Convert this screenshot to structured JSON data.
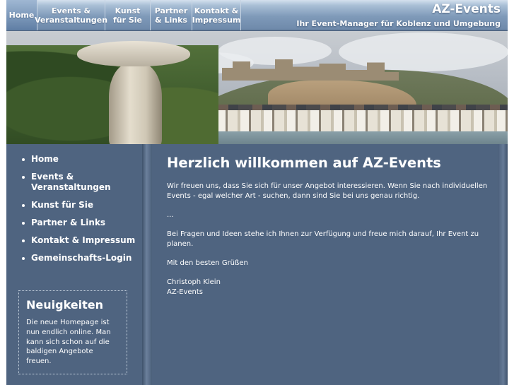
{
  "nav": {
    "items": [
      {
        "label": "Home",
        "active": true
      },
      {
        "label": "Events &\nVeranstaltungen",
        "active": false
      },
      {
        "label": "Kunst\nfür Sie",
        "active": false
      },
      {
        "label": "Partner\n& Links",
        "active": false
      },
      {
        "label": "Kontakt &\nImpressum",
        "active": false
      }
    ]
  },
  "brand": {
    "title": "AZ-Events",
    "subtitle": "Ihr Event-Manager für Koblenz und Umgebung"
  },
  "sidebar": {
    "menu": [
      {
        "label": "Home"
      },
      {
        "label": "Events & Veranstaltungen"
      },
      {
        "label": "Kunst für Sie"
      },
      {
        "label": "Partner & Links"
      },
      {
        "label": "Kontakt & Impressum"
      },
      {
        "label": "Gemeinschafts-Login"
      }
    ],
    "news": {
      "title": "Neuigkeiten",
      "text": "Die neue Homepage ist nun endlich online. Man kann sich schon auf die baldigen Angebote freuen."
    }
  },
  "main": {
    "heading": "Herzlich willkommen auf AZ-Events",
    "paragraphs": [
      "Wir freuen uns, dass Sie sich für unser Angebot interessieren. Wenn Sie nach individuellen Events - egal welcher Art - suchen, dann sind Sie bei uns genau richtig.",
      "...",
      "Bei Fragen und Ideen stehe ich Ihnen zur Verfügung und freue mich darauf, Ihr Event zu planen.",
      "Mit den besten Grüßen",
      "Christoph Klein\nAZ-Events"
    ]
  },
  "colors": {
    "background": "#4f6480",
    "nav_gradient_top": "#d5e1ee",
    "nav_gradient_bottom": "#6e89aa",
    "text": "#ffffff"
  }
}
